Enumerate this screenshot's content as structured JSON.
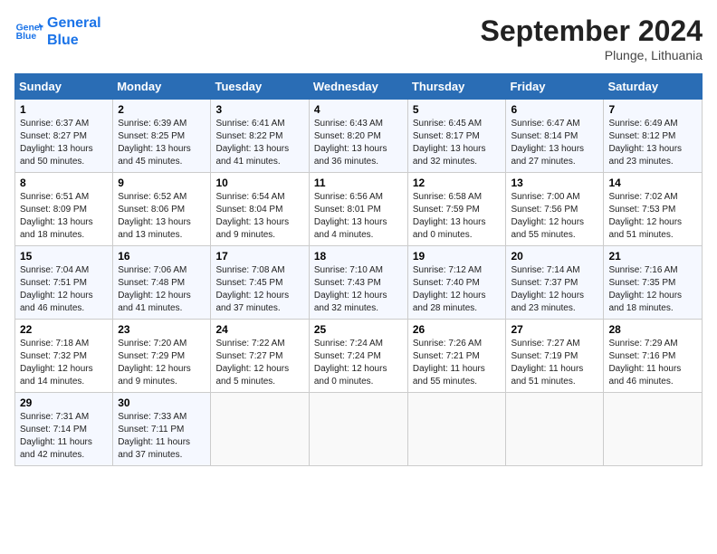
{
  "header": {
    "logo_line1": "General",
    "logo_line2": "Blue",
    "month_title": "September 2024",
    "location": "Plunge, Lithuania"
  },
  "days_of_week": [
    "Sunday",
    "Monday",
    "Tuesday",
    "Wednesday",
    "Thursday",
    "Friday",
    "Saturday"
  ],
  "weeks": [
    [
      {
        "day": "1",
        "info": "Sunrise: 6:37 AM\nSunset: 8:27 PM\nDaylight: 13 hours\nand 50 minutes."
      },
      {
        "day": "2",
        "info": "Sunrise: 6:39 AM\nSunset: 8:25 PM\nDaylight: 13 hours\nand 45 minutes."
      },
      {
        "day": "3",
        "info": "Sunrise: 6:41 AM\nSunset: 8:22 PM\nDaylight: 13 hours\nand 41 minutes."
      },
      {
        "day": "4",
        "info": "Sunrise: 6:43 AM\nSunset: 8:20 PM\nDaylight: 13 hours\nand 36 minutes."
      },
      {
        "day": "5",
        "info": "Sunrise: 6:45 AM\nSunset: 8:17 PM\nDaylight: 13 hours\nand 32 minutes."
      },
      {
        "day": "6",
        "info": "Sunrise: 6:47 AM\nSunset: 8:14 PM\nDaylight: 13 hours\nand 27 minutes."
      },
      {
        "day": "7",
        "info": "Sunrise: 6:49 AM\nSunset: 8:12 PM\nDaylight: 13 hours\nand 23 minutes."
      }
    ],
    [
      {
        "day": "8",
        "info": "Sunrise: 6:51 AM\nSunset: 8:09 PM\nDaylight: 13 hours\nand 18 minutes."
      },
      {
        "day": "9",
        "info": "Sunrise: 6:52 AM\nSunset: 8:06 PM\nDaylight: 13 hours\nand 13 minutes."
      },
      {
        "day": "10",
        "info": "Sunrise: 6:54 AM\nSunset: 8:04 PM\nDaylight: 13 hours\nand 9 minutes."
      },
      {
        "day": "11",
        "info": "Sunrise: 6:56 AM\nSunset: 8:01 PM\nDaylight: 13 hours\nand 4 minutes."
      },
      {
        "day": "12",
        "info": "Sunrise: 6:58 AM\nSunset: 7:59 PM\nDaylight: 13 hours\nand 0 minutes."
      },
      {
        "day": "13",
        "info": "Sunrise: 7:00 AM\nSunset: 7:56 PM\nDaylight: 12 hours\nand 55 minutes."
      },
      {
        "day": "14",
        "info": "Sunrise: 7:02 AM\nSunset: 7:53 PM\nDaylight: 12 hours\nand 51 minutes."
      }
    ],
    [
      {
        "day": "15",
        "info": "Sunrise: 7:04 AM\nSunset: 7:51 PM\nDaylight: 12 hours\nand 46 minutes."
      },
      {
        "day": "16",
        "info": "Sunrise: 7:06 AM\nSunset: 7:48 PM\nDaylight: 12 hours\nand 41 minutes."
      },
      {
        "day": "17",
        "info": "Sunrise: 7:08 AM\nSunset: 7:45 PM\nDaylight: 12 hours\nand 37 minutes."
      },
      {
        "day": "18",
        "info": "Sunrise: 7:10 AM\nSunset: 7:43 PM\nDaylight: 12 hours\nand 32 minutes."
      },
      {
        "day": "19",
        "info": "Sunrise: 7:12 AM\nSunset: 7:40 PM\nDaylight: 12 hours\nand 28 minutes."
      },
      {
        "day": "20",
        "info": "Sunrise: 7:14 AM\nSunset: 7:37 PM\nDaylight: 12 hours\nand 23 minutes."
      },
      {
        "day": "21",
        "info": "Sunrise: 7:16 AM\nSunset: 7:35 PM\nDaylight: 12 hours\nand 18 minutes."
      }
    ],
    [
      {
        "day": "22",
        "info": "Sunrise: 7:18 AM\nSunset: 7:32 PM\nDaylight: 12 hours\nand 14 minutes."
      },
      {
        "day": "23",
        "info": "Sunrise: 7:20 AM\nSunset: 7:29 PM\nDaylight: 12 hours\nand 9 minutes."
      },
      {
        "day": "24",
        "info": "Sunrise: 7:22 AM\nSunset: 7:27 PM\nDaylight: 12 hours\nand 5 minutes."
      },
      {
        "day": "25",
        "info": "Sunrise: 7:24 AM\nSunset: 7:24 PM\nDaylight: 12 hours\nand 0 minutes."
      },
      {
        "day": "26",
        "info": "Sunrise: 7:26 AM\nSunset: 7:21 PM\nDaylight: 11 hours\nand 55 minutes."
      },
      {
        "day": "27",
        "info": "Sunrise: 7:27 AM\nSunset: 7:19 PM\nDaylight: 11 hours\nand 51 minutes."
      },
      {
        "day": "28",
        "info": "Sunrise: 7:29 AM\nSunset: 7:16 PM\nDaylight: 11 hours\nand 46 minutes."
      }
    ],
    [
      {
        "day": "29",
        "info": "Sunrise: 7:31 AM\nSunset: 7:14 PM\nDaylight: 11 hours\nand 42 minutes."
      },
      {
        "day": "30",
        "info": "Sunrise: 7:33 AM\nSunset: 7:11 PM\nDaylight: 11 hours\nand 37 minutes."
      },
      {
        "day": "",
        "info": ""
      },
      {
        "day": "",
        "info": ""
      },
      {
        "day": "",
        "info": ""
      },
      {
        "day": "",
        "info": ""
      },
      {
        "day": "",
        "info": ""
      }
    ]
  ]
}
